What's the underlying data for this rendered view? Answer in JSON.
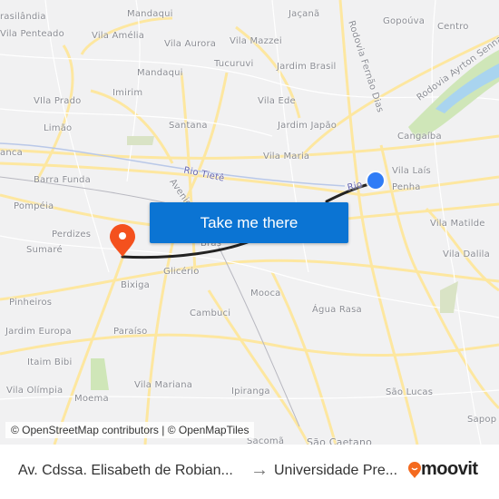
{
  "map": {
    "labels": [
      "rasilândia",
      "Mandaqui",
      "Jaçanã",
      "Gopoúva",
      "Centro",
      "Vila Penteado",
      "Vila Amélia",
      "Vila Aurora",
      "Vila Mazzei",
      "Rodovia Fernão Dias",
      "Rodovia Ayrton Senna",
      "Tucuruvi",
      "Jardim Brasil",
      "Mandaqui",
      "Imirim",
      "VIla Prado",
      "Vila Ede",
      "Limão",
      "Santana",
      "Jardim Japão",
      "Cangaíba",
      "anca",
      "Vila Maria",
      "Vila Laís",
      "Penha",
      "Barra Funda",
      "Rio Tietê",
      "Avenida",
      "Rio",
      "Pompéia",
      "Perdizes",
      "Sumaré",
      "Brás",
      "Glicério",
      "Vila Matilde",
      "Vila Dalila",
      "Bixiga",
      "Pinheiros",
      "Mooca",
      "Cambuci",
      "Água Rasa",
      "Jardim Europa",
      "Paraíso",
      "Itaim Bibi",
      "Vila Olímpia",
      "Moema",
      "Vila Mariana",
      "Ipiranga",
      "São Lucas",
      "Sapop",
      "Sacomã",
      "São Caetano"
    ],
    "attribution": "© OpenStreetMap contributors | © OpenMapTiles",
    "origin_icon": "blue-dot-icon",
    "destination_icon": "map-pin-icon",
    "colors": {
      "route": "#222222",
      "origin": "#2f7cf6",
      "destination": "#f4511e",
      "button": "#0b74d3",
      "roads": "#fde9a3"
    }
  },
  "cta": {
    "label": "Take me there"
  },
  "footer": {
    "from": "Av. Cdssa. Elisabeth de Robian...",
    "arrow_icon": "arrow-right-icon",
    "to": "Universidade Pre...",
    "brand": "moovit",
    "brand_color": "#f46a1f"
  }
}
